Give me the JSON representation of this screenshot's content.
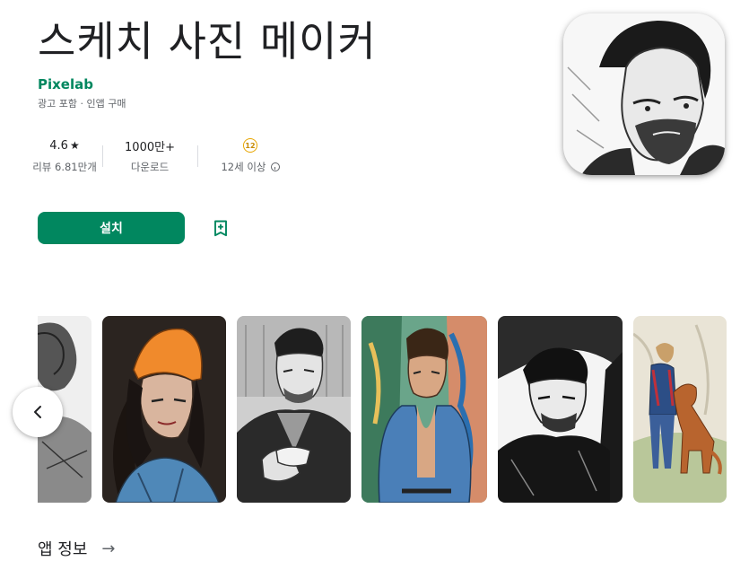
{
  "app": {
    "title": "스케치 사진 메이커",
    "developer": "Pixelab",
    "subline": "광고 포함 · 인앱 구매"
  },
  "stats": {
    "rating_value": "4.6",
    "rating_star": "★",
    "rating_reviews": "리뷰 6.81만개",
    "installs_value": "1000만+",
    "installs_label": "다운로드",
    "age_badge": "12",
    "age_label": "12세 이상"
  },
  "actions": {
    "install_label": "설치"
  },
  "icons": {
    "wishlist": "bookmark-add-icon",
    "info": "info-icon",
    "prev": "chevron-left-icon",
    "about_arrow": "arrow-right-icon"
  },
  "about": {
    "label": "앱 정보",
    "arrow": "→"
  },
  "colors": {
    "accent": "#01875f",
    "age_badge": "#e8a600",
    "text_primary": "#202124",
    "text_secondary": "#5f6368"
  }
}
